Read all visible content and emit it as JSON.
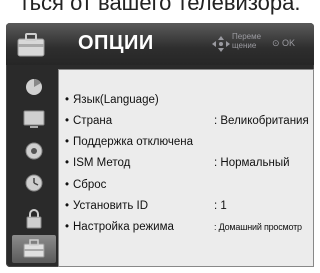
{
  "background_text": "ться от вашего телевизора.",
  "menu": {
    "title": "ОПЦИИ",
    "hint_move": "Переме щение",
    "hint_ok": "⊙ OK"
  },
  "sidebar": {
    "items": [
      {
        "name": "picture-icon"
      },
      {
        "name": "display-icon"
      },
      {
        "name": "audio-icon"
      },
      {
        "name": "time-icon"
      },
      {
        "name": "lock-icon"
      },
      {
        "name": "options-icon",
        "active": true
      }
    ]
  },
  "options": {
    "items": [
      {
        "label": "Язык(Language)",
        "value": ""
      },
      {
        "label": "Страна",
        "value": ": Великобритания"
      },
      {
        "label": "Поддержка отключена",
        "value": ""
      },
      {
        "label": "ISM Метод",
        "value": ": Нормальный"
      },
      {
        "label": "Сброс",
        "value": ""
      },
      {
        "label": "Установить ID",
        "value": ": 1"
      },
      {
        "label": "Настройка режима",
        "value": ": Домашний просмотр"
      }
    ]
  },
  "colors": {
    "panel": "#2a2a2a",
    "list_bg": "#ececec",
    "active_tab": "#7a7a7a",
    "hint_text": "#9a9aa0"
  }
}
